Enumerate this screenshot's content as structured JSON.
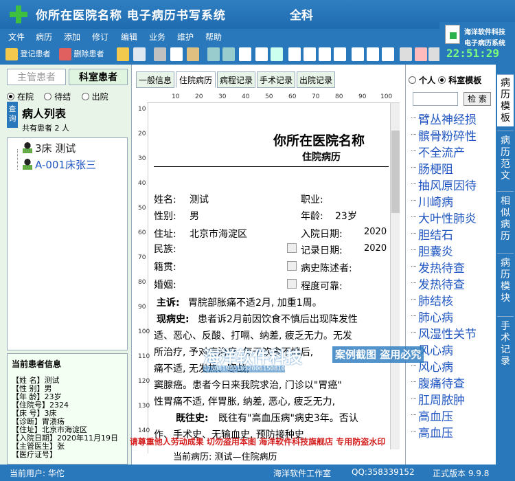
{
  "window": {
    "title": "你所在医院名称  电子病历书写系统",
    "department": "全科"
  },
  "menu": [
    "文件",
    "病历",
    "添加",
    "修订",
    "编辑",
    "业务",
    "维护",
    "帮助"
  ],
  "toolbar": {
    "register_label": "登记患者",
    "delete_label": "删除患者"
  },
  "logo": {
    "line1": "海洋软件科技",
    "line2": "电子病历系统",
    "clock": "22:51:29"
  },
  "left": {
    "tab_manager": "主管患者",
    "tab_dept": "科室患者",
    "radio_in": "在院",
    "radio_pending": "待结",
    "radio_out": "出院",
    "query_label": "查询",
    "list_title": "病人列表",
    "count_text": "共有患者 2 人",
    "patients": [
      "3床  测试",
      "A-001床张三"
    ]
  },
  "info": {
    "title": "当前患者信息",
    "lines": [
      "【姓  名】测试",
      "【性  别】男",
      "【年  龄】23岁",
      "【住院号】2324",
      "【床  号】3床",
      "【诊断】胃溃疡",
      "【住址】北京市海淀区",
      "【入院日期】2020年11月19日",
      "【主管医生】张",
      "【医疗证号】"
    ]
  },
  "tabs": [
    "一般信息",
    "住院病历",
    "病程记录",
    "手术记录",
    "出院记录"
  ],
  "ruler": {
    "h": [
      "10",
      "20",
      "30",
      "40",
      "50",
      "60",
      "70",
      "80",
      "90",
      "100"
    ],
    "v": [
      "10",
      "20",
      "30",
      "40",
      "50",
      "60",
      "70",
      "80",
      "90",
      "100",
      "110",
      "120",
      "130",
      "140"
    ]
  },
  "doc": {
    "hospital": "你所在医院名称",
    "record_type": "住院病历",
    "name_label": "姓名:",
    "name": "测试",
    "job_label": "职业:",
    "sex_label": "性别:",
    "sex": "男",
    "age_label": "年龄:",
    "age": "23岁",
    "addr_label": "住址:",
    "addr": "北京市海淀区",
    "admit_label": "入院日期:",
    "admit": "2020",
    "ethnic_label": "民族:",
    "record_label": "记录日期:",
    "record": "2020",
    "native_label": "籍贯:",
    "narrator_label": "病史陈述者:",
    "marital_label": "婚姻:",
    "reliable_label": "程度可靠:",
    "complaint_label": "主诉:",
    "complaint": "胃脘部胀痛不适2月, 加重1周。",
    "hpi_label": "现病史:",
    "hpi": [
      "患者诉2月前因饮食不慎后出现阵发性",
      "适、恶心、反酸、打嗝、纳差, 疲乏无力。无发",
      "所治疗, 予对症治疗, 每于饮食不慎后, ",
      "痛不适, 无发热、寒战, ",
      "窦腺癌。患者今日来我院求治, 门诊以\"胃癌\"",
      "性胃痛不适, 伴胃胀, 纳差, 恶心, 疲乏无力, "
    ],
    "pmh_label": "既往史:",
    "pmh": "既往有\"高血压病\"病史3年。否认",
    "last_line": "作、手术史、无输血史, 预防接种史"
  },
  "bottom_tab": "当前病历: 测试—住院病历",
  "right": {
    "opt_personal": "个人",
    "opt_dept": "科室模板",
    "search_btn": "检 索",
    "items": [
      "臂丛神经损",
      "髌骨粉碎性",
      "不全流产",
      "肠梗阻",
      "抽风原因待",
      "川崎病",
      "大叶性肺炎",
      "胆结石",
      "胆囊炎",
      "发热待查",
      "发热待查",
      "肺结核",
      "肺心病",
      "风湿性关节",
      "风心病",
      "风心病",
      "腹痛待查",
      "肛周脓肿",
      "高血压",
      "高血压"
    ]
  },
  "vtabs": [
    "病历模板",
    "病历范文",
    "相似病历",
    "病历模块",
    "手术记录"
  ],
  "watermark": {
    "big": "海洋软件科技",
    "box": "案例截图 盗用必究",
    "nums": "1750819861852006150810"
  },
  "warning": "请尊重他人劳动成果  切勿盗用本图  海洋软件科技旗舰店  专用防盗水印",
  "status": {
    "user": "当前用户: 华佗",
    "studio": "海洋软件工作室",
    "qq": "QQ:358339152",
    "version": "正式版本 9.9.8"
  }
}
